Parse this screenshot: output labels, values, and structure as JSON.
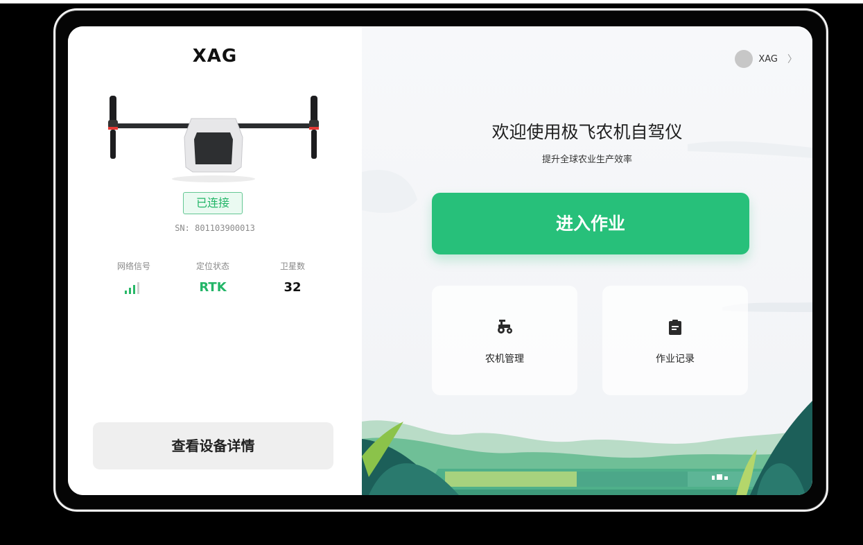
{
  "brand": {
    "logo_text": "XAG"
  },
  "device": {
    "status": "已连接",
    "sn": "SN: 801103900013",
    "stats": {
      "network_label": "网络信号",
      "position_label": "定位状态",
      "position_value": "RTK",
      "satellites_label": "卫星数",
      "satellites_value": "32"
    },
    "details_button": "查看设备详情"
  },
  "user": {
    "name": "XAG",
    "chevron": "〉"
  },
  "welcome": {
    "title": "欢迎使用极飞农机自驾仪",
    "subtitle": "提升全球农业生产效率"
  },
  "actions": {
    "enter_work": "进入作业",
    "machine_mgmt": "农机管理",
    "work_records": "作业记录"
  },
  "icons": {
    "tractor": "tractor-icon",
    "records": "clipboard-icon",
    "signal": "signal-icon"
  },
  "colors": {
    "accent": "#27c07a",
    "status_green": "#22b567"
  }
}
